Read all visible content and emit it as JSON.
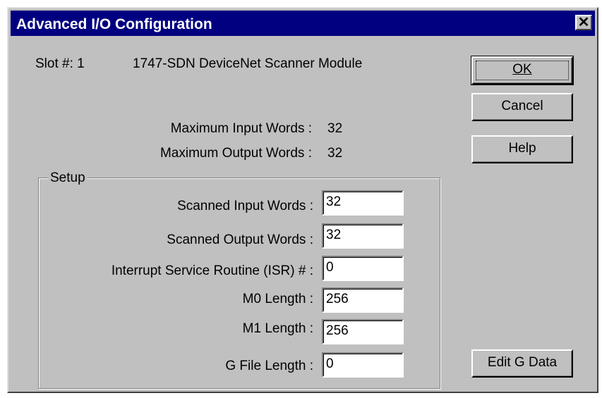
{
  "window": {
    "title": "Advanced I/O Configuration",
    "close_glyph": "✕"
  },
  "info": {
    "slot_label": "Slot #: 1",
    "module_name": "1747-SDN DeviceNet Scanner Module",
    "max_input_label": "Maximum Input Words :",
    "max_input_value": "32",
    "max_output_label": "Maximum Output Words :",
    "max_output_value": "32"
  },
  "buttons": {
    "ok": "OK",
    "cancel": "Cancel",
    "help": "Help",
    "edit_g_data": "Edit G Data"
  },
  "setup": {
    "group_label": "Setup",
    "fields": [
      {
        "label": "Scanned Input Words :",
        "value": "32"
      },
      {
        "label": "Scanned Output Words :",
        "value": "32"
      },
      {
        "label": "Interrupt Service Routine (ISR) # :",
        "value": "0"
      },
      {
        "label": "M0  Length :",
        "value": "256"
      },
      {
        "label": "M1  Length :",
        "value": "256"
      },
      {
        "label": "G File Length :",
        "value": "0"
      }
    ]
  }
}
